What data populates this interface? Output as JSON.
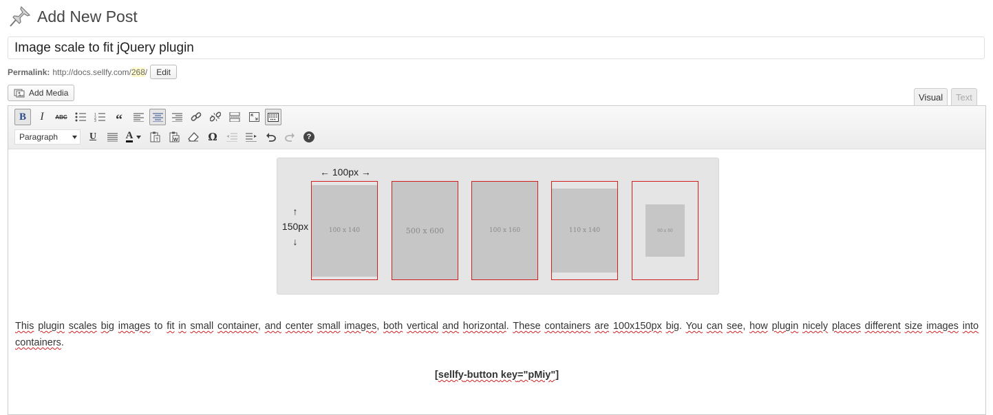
{
  "header": {
    "title": "Add New Post",
    "icon": "pushpin-icon"
  },
  "post_title": "Image scale to fit jQuery plugin",
  "permalink": {
    "label": "Permalink:",
    "base": "http://docs.sellfy.com/",
    "slug": "268",
    "suffix": "/",
    "edit_label": "Edit"
  },
  "media": {
    "add_label": "Add Media"
  },
  "tabs": {
    "visual": "Visual",
    "text": "Text"
  },
  "toolbar": {
    "row1": [
      "bold",
      "italic",
      "strikethrough",
      "bullet-list",
      "numbered-list",
      "blockquote",
      "align-left",
      "align-center",
      "align-right",
      "insert-link",
      "unlink",
      "read-more",
      "fullscreen",
      "toolbar-toggle"
    ],
    "row2_format": "Paragraph",
    "row2": [
      "underline",
      "justify",
      "text-color",
      "paste-as-text",
      "paste-from-word",
      "clear-formatting",
      "special-character",
      "outdent",
      "indent",
      "undo",
      "redo",
      "help"
    ],
    "bold_glyph": "B",
    "italic_glyph": "I",
    "strike_glyph": "ABC",
    "underline_glyph": "U",
    "textcolor_glyph": "A",
    "omega_glyph": "Ω",
    "help_glyph": "?"
  },
  "figure": {
    "width_label": "← 100px →",
    "height_up": "↑",
    "height_label": "150px",
    "height_down": "↓",
    "images": [
      {
        "label": "100 x 140"
      },
      {
        "label": "500 x 600"
      },
      {
        "label": "100 x 160"
      },
      {
        "label": "110 x 140"
      },
      {
        "label": "60 x 80"
      }
    ]
  },
  "body": {
    "paragraph": [
      {
        "t": "This",
        "s": true
      },
      {
        "t": " ",
        "s": false
      },
      {
        "t": "plugin",
        "s": true
      },
      {
        "t": " ",
        "s": false
      },
      {
        "t": "scales",
        "s": true
      },
      {
        "t": " ",
        "s": false
      },
      {
        "t": "big",
        "s": true
      },
      {
        "t": " ",
        "s": false
      },
      {
        "t": "images",
        "s": true
      },
      {
        "t": " to ",
        "s": false
      },
      {
        "t": "fit",
        "s": true
      },
      {
        "t": " ",
        "s": false
      },
      {
        "t": "in",
        "s": true
      },
      {
        "t": " ",
        "s": false
      },
      {
        "t": "small",
        "s": true
      },
      {
        "t": " ",
        "s": false
      },
      {
        "t": "container",
        "s": true
      },
      {
        "t": ", ",
        "s": false
      },
      {
        "t": "and",
        "s": true
      },
      {
        "t": " ",
        "s": false
      },
      {
        "t": "center",
        "s": true
      },
      {
        "t": " ",
        "s": false
      },
      {
        "t": "small",
        "s": true
      },
      {
        "t": " ",
        "s": false
      },
      {
        "t": "images",
        "s": true
      },
      {
        "t": ", ",
        "s": false
      },
      {
        "t": "both",
        "s": true
      },
      {
        "t": " ",
        "s": false
      },
      {
        "t": "vertical",
        "s": true
      },
      {
        "t": " ",
        "s": false
      },
      {
        "t": "and",
        "s": true
      },
      {
        "t": " ",
        "s": false
      },
      {
        "t": "horizontal",
        "s": true
      },
      {
        "t": ". ",
        "s": false
      },
      {
        "t": "These",
        "s": true
      },
      {
        "t": " ",
        "s": false
      },
      {
        "t": "containers",
        "s": true
      },
      {
        "t": " ",
        "s": false
      },
      {
        "t": "are",
        "s": true
      },
      {
        "t": " ",
        "s": false
      },
      {
        "t": "100x150px",
        "s": true
      },
      {
        "t": " ",
        "s": false
      },
      {
        "t": "big",
        "s": true
      },
      {
        "t": ". ",
        "s": false
      },
      {
        "t": "You",
        "s": true
      },
      {
        "t": " ",
        "s": false
      },
      {
        "t": "can",
        "s": true
      },
      {
        "t": " ",
        "s": false
      },
      {
        "t": "see",
        "s": true
      },
      {
        "t": ", ",
        "s": false
      },
      {
        "t": "how",
        "s": true
      },
      {
        "t": " ",
        "s": false
      },
      {
        "t": "plugin",
        "s": true
      },
      {
        "t": " ",
        "s": false
      },
      {
        "t": "nicely",
        "s": true
      },
      {
        "t": " ",
        "s": false
      },
      {
        "t": "places",
        "s": true
      },
      {
        "t": " ",
        "s": false
      },
      {
        "t": "different",
        "s": true
      },
      {
        "t": " ",
        "s": false
      },
      {
        "t": "size",
        "s": true
      },
      {
        "t": " ",
        "s": false
      },
      {
        "t": "images",
        "s": true
      },
      {
        "t": " ",
        "s": false
      },
      {
        "t": "into",
        "s": true
      },
      {
        "t": " ",
        "s": false
      },
      {
        "t": "containers",
        "s": true
      },
      {
        "t": ".",
        "s": false
      }
    ],
    "shortcode": [
      {
        "t": "[",
        "s": false
      },
      {
        "t": "sellfy",
        "s": true
      },
      {
        "t": "-button ",
        "s": false
      },
      {
        "t": "key",
        "s": true
      },
      {
        "t": "=\"",
        "s": false
      },
      {
        "t": "pMiy",
        "s": true
      },
      {
        "t": "\"]",
        "s": false
      }
    ]
  },
  "colors": {
    "container_border": "#d21c1c",
    "image_fill": "#c6c6c6",
    "figure_bg": "#e5e5e5",
    "spellcheck": "#d41c1c"
  }
}
